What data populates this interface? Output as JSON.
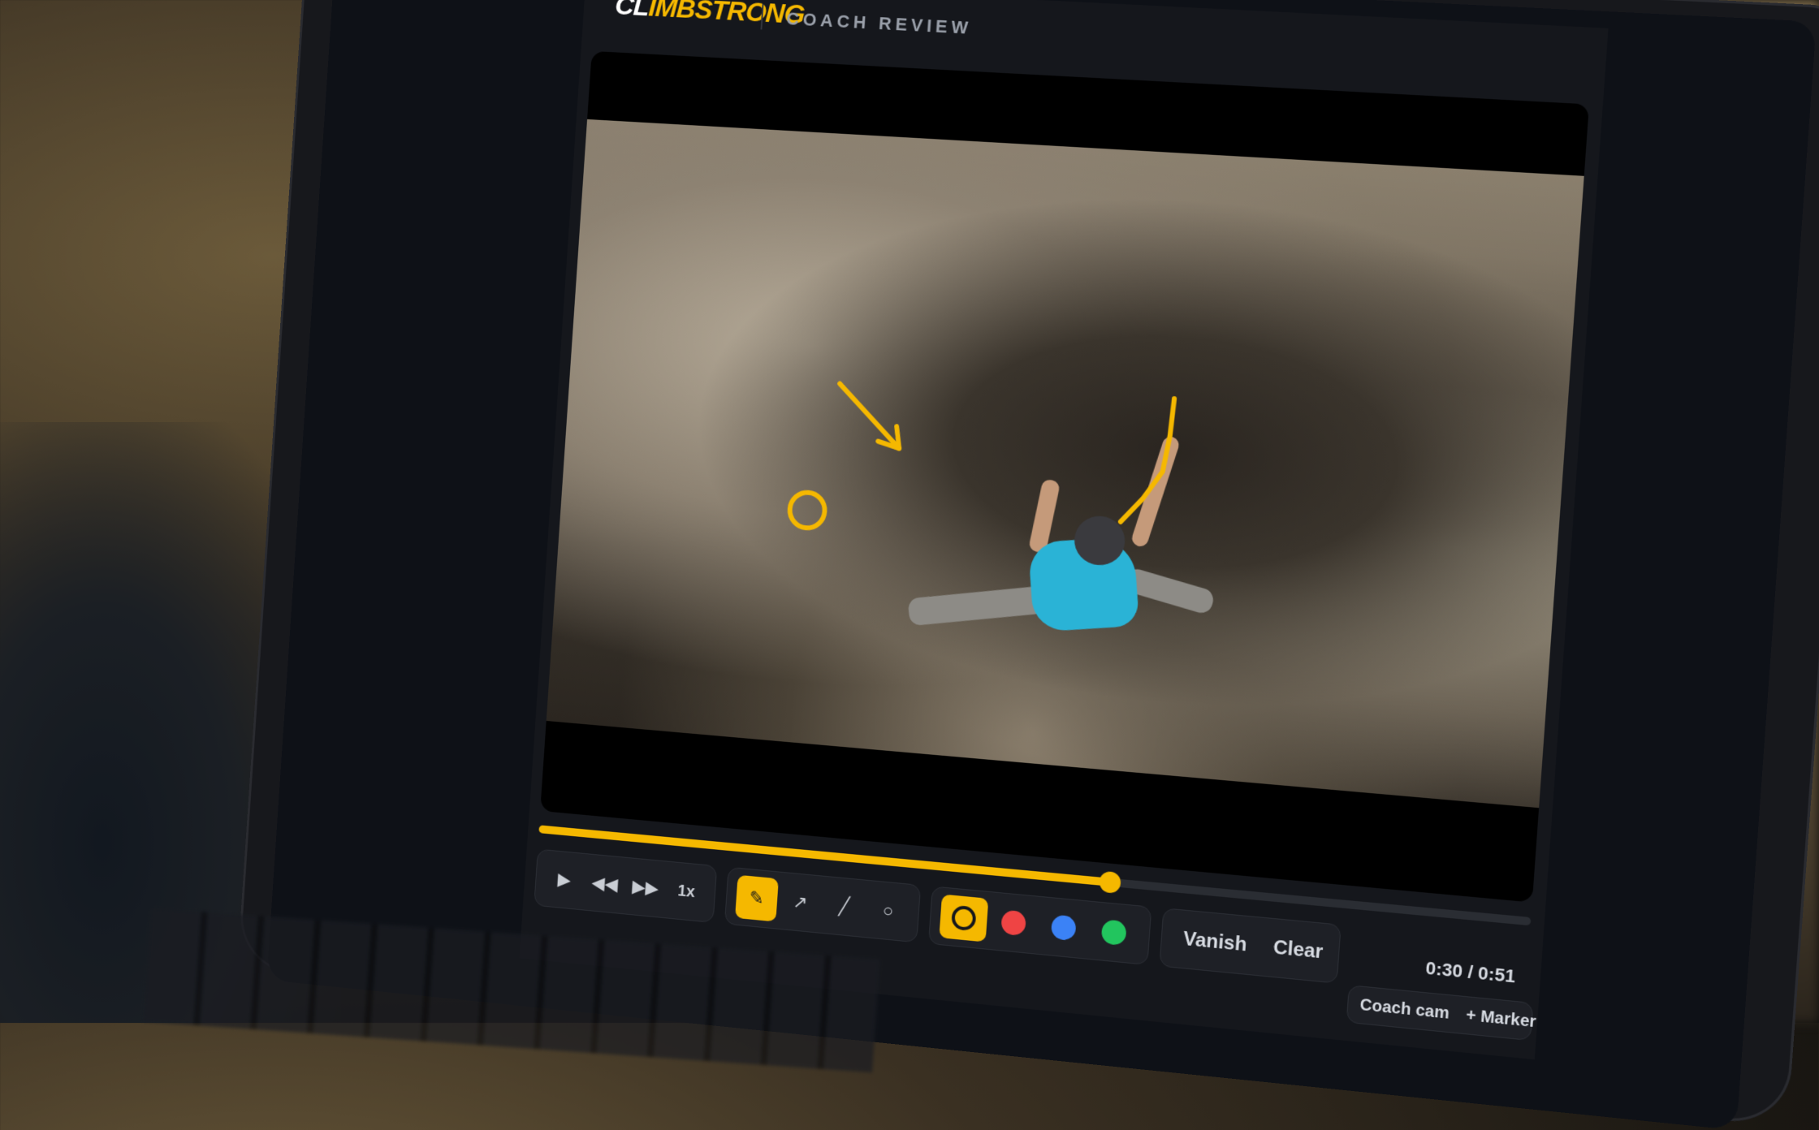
{
  "app": {
    "logo_climb": "CL",
    "logo_imb": "IMB",
    "logo_strong": "STRONG",
    "title": "COACH REVIEW"
  },
  "player": {
    "progress": 0.588,
    "time_current": "0:30",
    "time_total": "0:51",
    "time_display": "0:30 / 0:51"
  },
  "playback": {
    "play_icon": "play-icon",
    "rewind_icon": "rewind-icon",
    "forward_icon": "fast-forward-icon",
    "speed_label": "1x"
  },
  "tools": [
    {
      "name": "pen-tool",
      "icon": "pencil-icon",
      "glyph": "✎",
      "active": true
    },
    {
      "name": "arrow-tool",
      "icon": "arrow-icon",
      "glyph": "↗",
      "active": false
    },
    {
      "name": "line-tool",
      "icon": "line-icon",
      "glyph": "╱",
      "active": false
    },
    {
      "name": "circle-tool",
      "icon": "circle-icon",
      "glyph": "○",
      "active": false
    }
  ],
  "colors": [
    {
      "name": "yellow",
      "hex": "#f5b800",
      "active": true
    },
    {
      "name": "red",
      "hex": "#ef4444",
      "active": false
    },
    {
      "name": "blue",
      "hex": "#3b82f6",
      "active": false
    },
    {
      "name": "green",
      "hex": "#22c55e",
      "active": false
    }
  ],
  "actions": {
    "vanish_label": "Vanish",
    "clear_label": "Clear",
    "coach_cam_label": "Coach cam",
    "marker_label": "+ Marker"
  },
  "annotation_color": "#f5b800"
}
